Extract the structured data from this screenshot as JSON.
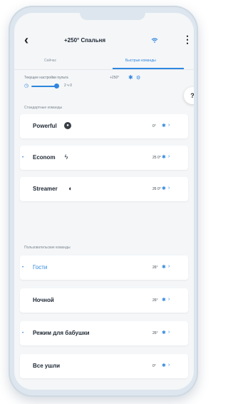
{
  "header": {
    "back_icon": "chevron-left-icon",
    "title": "+250° Спальня",
    "wifi_icon": "wifi-icon",
    "more_icon": "kebab-menu-icon"
  },
  "tabs": [
    {
      "label": "Сейчас",
      "active": false
    },
    {
      "label": "Быстрые команды",
      "active": true
    }
  ],
  "setpoint": {
    "label": "Текущее настройки пульта",
    "value": "+250°",
    "minutes": "2 ч 0",
    "help_label": "?"
  },
  "sections": {
    "standard_title": "Стандартные команды",
    "custom_title": "Пользовательские команды"
  },
  "standard_modes": [
    {
      "name": "Powerful",
      "icon": "dark-circle-icon",
      "temp": "0°",
      "dot": false
    },
    {
      "name": "Econom",
      "icon": "bolt-icon",
      "temp": "25 0°",
      "dot": true
    },
    {
      "name": "Streamer",
      "icon": "moon-icon",
      "temp": "26 0°",
      "dot": false
    }
  ],
  "custom_modes": [
    {
      "name": "Гости",
      "temp": "26°",
      "dot": true,
      "accent": true
    },
    {
      "name": "Ночной",
      "temp": "26°",
      "dot": false,
      "accent": false
    },
    {
      "name": "Режим для бабушки",
      "temp": "26°",
      "dot": true,
      "accent": false
    },
    {
      "name": "Все ушли",
      "temp": "0°",
      "dot": false,
      "accent": false
    }
  ],
  "accent_color": "#2e86de"
}
